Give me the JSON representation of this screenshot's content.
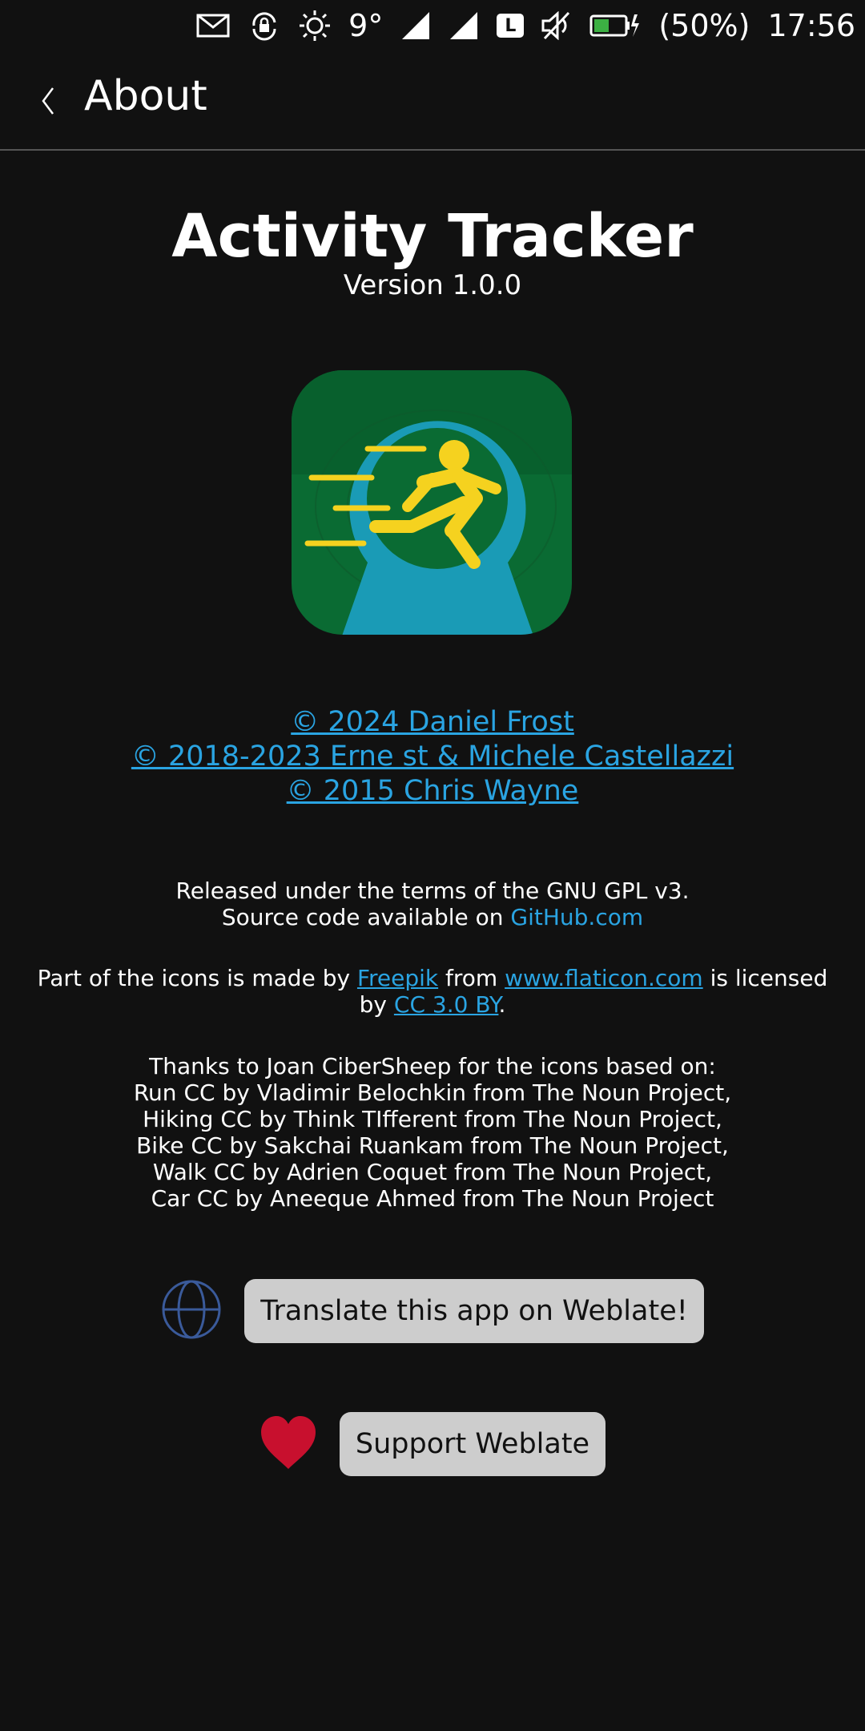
{
  "status_bar": {
    "temperature": "9°",
    "network_label": "L",
    "battery_percent": "(50%)",
    "battery_level": 0.5,
    "time": "17:56"
  },
  "header": {
    "title": "About"
  },
  "app": {
    "name": "Activity Tracker",
    "version": "Version 1.0.0"
  },
  "copyright": [
    "© 2024 Daniel Frost",
    "© 2018-2023 Erne st & Michele Castellazzi",
    "© 2015 Chris Wayne"
  ],
  "license": {
    "line1": "Released under the terms of the GNU GPL v3.",
    "line2_prefix": "Source code available on ",
    "source_link": "GitHub.com"
  },
  "icons_credit": {
    "prefix": "Part of the icons is made by ",
    "author_link": "Freepik",
    "from_text": " from ",
    "site_link": "www.flaticon.com",
    "licensed_text": " is licensed by ",
    "license_link": "CC 3.0 BY",
    "suffix": "."
  },
  "thanks": [
    "Thanks to Joan CiberSheep for the icons based on:",
    "Run CC by Vladimir Belochkin from The Noun Project,",
    "Hiking CC by Think TIfferent from The Noun Project,",
    "Bike CC by Sakchai Ruankam from The Noun Project,",
    "Walk CC by Adrien Coquet from The Noun Project,",
    "Car CC by Aneeque Ahmed from The Noun Project"
  ],
  "actions": {
    "translate_label": "Translate this app on Weblate!",
    "support_label": "Support Weblate"
  },
  "colors": {
    "background": "#111111",
    "link": "#2aa4e2",
    "button": "#cdcdcd",
    "heart": "#c8102e",
    "globe": "#3a5a9a",
    "icon_green": "#0a6b33",
    "icon_blue": "#1a9bb6",
    "icon_yellow": "#f5d21f"
  }
}
